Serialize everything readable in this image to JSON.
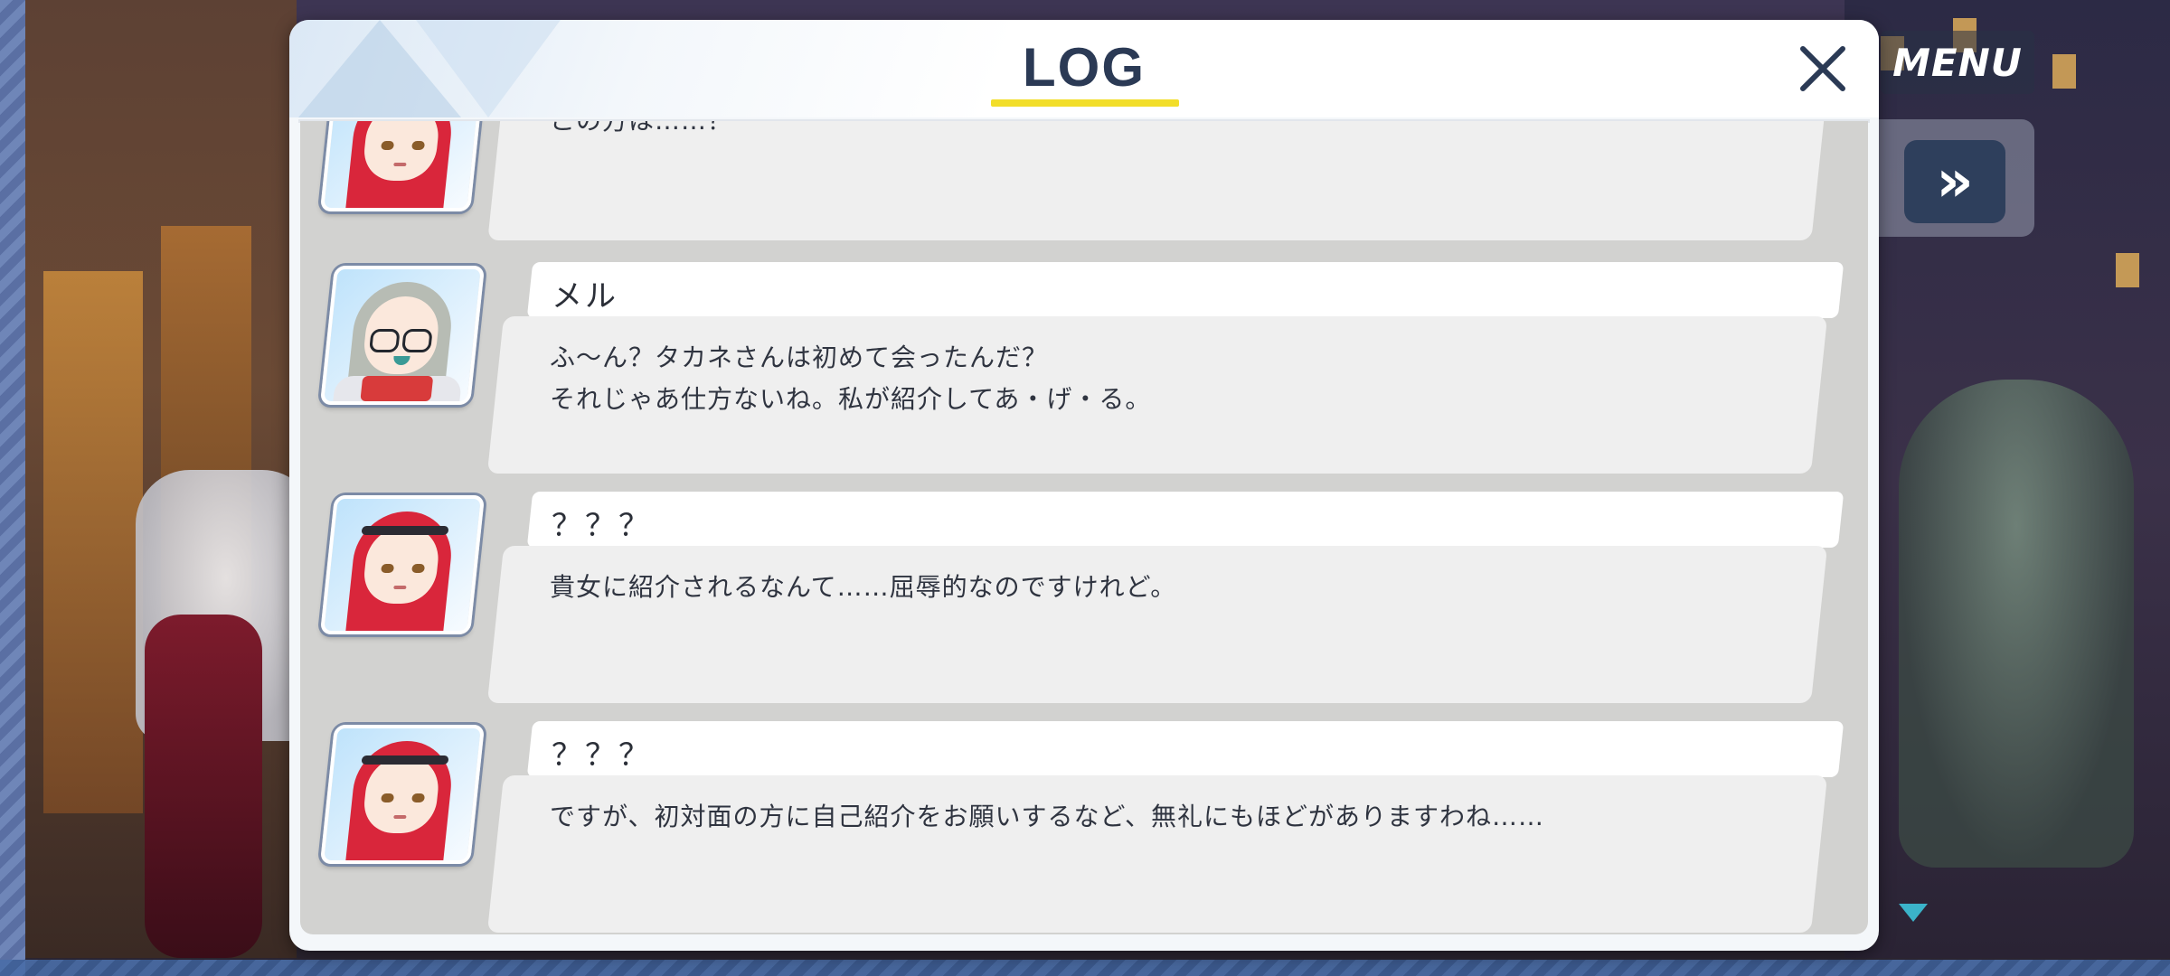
{
  "hud": {
    "menu_label": "MENU",
    "fast_forward_icon": "»"
  },
  "log": {
    "title": "LOG",
    "close_icon": "✕",
    "entries": [
      {
        "speaker": "",
        "avatar": "red-haired-girl",
        "lines": [
          "この方は……？"
        ]
      },
      {
        "speaker": "メル",
        "avatar": "silver-haired-girl-glasses",
        "lines": [
          "ふ〜ん？タカネさんは初めて会ったんだ？",
          "それじゃあ仕方ないね。私が紹介してあ・げ・る。"
        ]
      },
      {
        "speaker": "？？？",
        "avatar": "red-haired-girl",
        "lines": [
          "貴女に紹介されるなんて……屈辱的なのですけれど。"
        ]
      },
      {
        "speaker": "？？？",
        "avatar": "red-haired-girl",
        "lines": [
          "ですが、初対面の方に自己紹介をお願いするなど、無礼にもほどがありますわね……"
        ]
      }
    ]
  },
  "colors": {
    "accent_underline": "#f2de2a",
    "title_text": "#2b3a55",
    "hud_button": "#2e3f5c",
    "scroll_arrow": "#3bb3c9"
  }
}
